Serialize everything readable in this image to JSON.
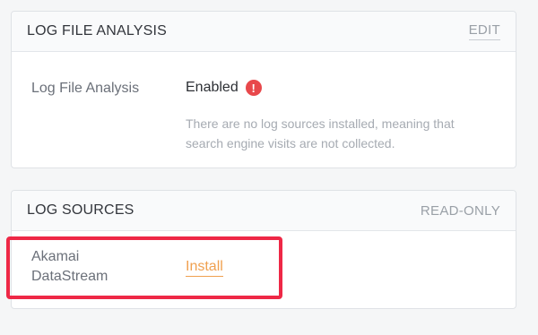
{
  "colors": {
    "accent": "#f0a04f",
    "alert": "#e8484b",
    "highlight": "#ee2846"
  },
  "log_file_analysis_card": {
    "title": "LOG FILE ANALYSIS",
    "action_label": "EDIT",
    "row_label": "Log File Analysis",
    "status_value": "Enabled",
    "status_icon": "alert-icon",
    "status_icon_glyph": "!",
    "status_note": "There are no log sources installed, meaning that search engine visits are not collected."
  },
  "log_sources_card": {
    "title": "LOG SOURCES",
    "mode_label": "READ-ONLY",
    "sources": [
      {
        "name": "Akamai DataStream",
        "action_label": "Install"
      }
    ]
  }
}
